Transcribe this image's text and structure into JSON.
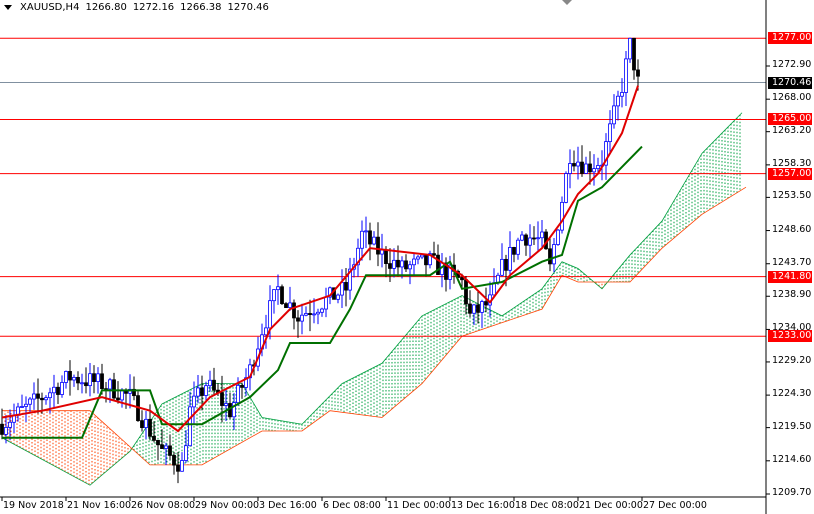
{
  "header": {
    "symbol": "XAUUSD,H4",
    "open": "1266.80",
    "high": "1272.16",
    "low": "1266.38",
    "close": "1270.46"
  },
  "price_axis": [
    "1272.90",
    "1268.00",
    "1263.20",
    "1258.30",
    "1253.50",
    "1248.60",
    "1243.70",
    "1238.90",
    "1234.00",
    "1229.20",
    "1224.30",
    "1219.50",
    "1214.60",
    "1209.70"
  ],
  "price_levels": [
    {
      "label": "1277.00",
      "price": 1277.0,
      "color": "#ff0000"
    },
    {
      "label": "1265.00",
      "price": 1265.0,
      "color": "#ff0000"
    },
    {
      "label": "1257.00",
      "price": 1257.0,
      "color": "#ff0000"
    },
    {
      "label": "1241.80",
      "price": 1241.8,
      "color": "#ff0000"
    },
    {
      "label": "1233.00",
      "price": 1233.0,
      "color": "#ff0000"
    }
  ],
  "current_price": {
    "label": "1270.46",
    "price": 1270.46,
    "color": "#000000"
  },
  "time_axis": [
    "19 Nov 2018",
    "21 Nov 16:00",
    "26 Nov 08:00",
    "29 Nov 00:00",
    "3 Dec 16:00",
    "6 Dec 08:00",
    "11 Dec 00:00",
    "13 Dec 16:00",
    "18 Dec 08:00",
    "21 Dec 00:00",
    "27 Dec 00:00"
  ],
  "colors": {
    "tenkan": "#e00000",
    "kijun": "#007000",
    "cloud_bull": "#00a040",
    "cloud_bear": "#ff4000",
    "up_candle": "#0000ff",
    "down_candle": "#000000"
  },
  "series": {
    "price_path": [
      [
        0,
        1220
      ],
      [
        10,
        1224
      ],
      [
        17,
        1227
      ],
      [
        25,
        1226
      ],
      [
        32,
        1224
      ],
      [
        40,
        1216
      ],
      [
        45,
        1214
      ],
      [
        47,
        1222
      ],
      [
        51,
        1226
      ],
      [
        57,
        1222
      ],
      [
        62,
        1228
      ],
      [
        65,
        1234
      ],
      [
        69,
        1240
      ],
      [
        74,
        1236
      ],
      [
        80,
        1238
      ],
      [
        86,
        1240
      ],
      [
        90,
        1248
      ],
      [
        95,
        1245
      ],
      [
        100,
        1243
      ],
      [
        107,
        1244
      ],
      [
        115,
        1241
      ],
      [
        117,
        1236
      ],
      [
        122,
        1238
      ],
      [
        125,
        1243
      ],
      [
        130,
        1248
      ],
      [
        135,
        1247
      ],
      [
        137,
        1243
      ],
      [
        142,
        1260
      ],
      [
        146,
        1258
      ],
      [
        150,
        1259
      ],
      [
        155,
        1270
      ],
      [
        157,
        1276
      ],
      [
        159,
        1270.46
      ]
    ],
    "tenkan": [
      [
        0,
        1221
      ],
      [
        10,
        1222
      ],
      [
        25,
        1224
      ],
      [
        37,
        1222
      ],
      [
        44,
        1219
      ],
      [
        52,
        1224
      ],
      [
        62,
        1227
      ],
      [
        67,
        1234
      ],
      [
        72,
        1237
      ],
      [
        82,
        1239
      ],
      [
        92,
        1246
      ],
      [
        107,
        1245
      ],
      [
        115,
        1242
      ],
      [
        122,
        1238
      ],
      [
        127,
        1242
      ],
      [
        135,
        1246
      ],
      [
        140,
        1250
      ],
      [
        144,
        1254
      ],
      [
        149,
        1257
      ],
      [
        155,
        1263
      ],
      [
        159,
        1270
      ]
    ],
    "kijun": [
      [
        0,
        1218
      ],
      [
        20,
        1218
      ],
      [
        25,
        1225
      ],
      [
        37,
        1225
      ],
      [
        40,
        1220
      ],
      [
        50,
        1220
      ],
      [
        62,
        1224
      ],
      [
        69,
        1228
      ],
      [
        72,
        1232
      ],
      [
        82,
        1232
      ],
      [
        87,
        1237
      ],
      [
        91,
        1242
      ],
      [
        107,
        1242
      ],
      [
        112,
        1244
      ],
      [
        115,
        1240
      ],
      [
        125,
        1241
      ],
      [
        135,
        1244
      ],
      [
        140,
        1245
      ],
      [
        144,
        1253
      ],
      [
        150,
        1255
      ],
      [
        155,
        1258
      ],
      [
        160,
        1261
      ]
    ],
    "span_a": [
      [
        0,
        1218
      ],
      [
        22,
        1211
      ],
      [
        32,
        1216
      ],
      [
        40,
        1223
      ],
      [
        50,
        1226
      ],
      [
        60,
        1226
      ],
      [
        65,
        1221
      ],
      [
        75,
        1220
      ],
      [
        85,
        1226
      ],
      [
        95,
        1229
      ],
      [
        105,
        1236
      ],
      [
        115,
        1239
      ],
      [
        125,
        1236
      ],
      [
        135,
        1240
      ],
      [
        140,
        1244
      ],
      [
        144,
        1243
      ],
      [
        150,
        1240
      ],
      [
        157,
        1245
      ],
      [
        165,
        1250
      ],
      [
        175,
        1260
      ],
      [
        185,
        1266
      ]
    ],
    "span_b": [
      [
        0,
        1222
      ],
      [
        22,
        1222
      ],
      [
        37,
        1214
      ],
      [
        50,
        1214
      ],
      [
        65,
        1219
      ],
      [
        75,
        1219
      ],
      [
        82,
        1222
      ],
      [
        95,
        1221
      ],
      [
        105,
        1226
      ],
      [
        115,
        1233
      ],
      [
        125,
        1235
      ],
      [
        135,
        1237
      ],
      [
        140,
        1242
      ],
      [
        144,
        1241
      ],
      [
        150,
        1241
      ],
      [
        157,
        1241
      ],
      [
        165,
        1246
      ],
      [
        175,
        1251
      ],
      [
        186,
        1255
      ]
    ]
  }
}
